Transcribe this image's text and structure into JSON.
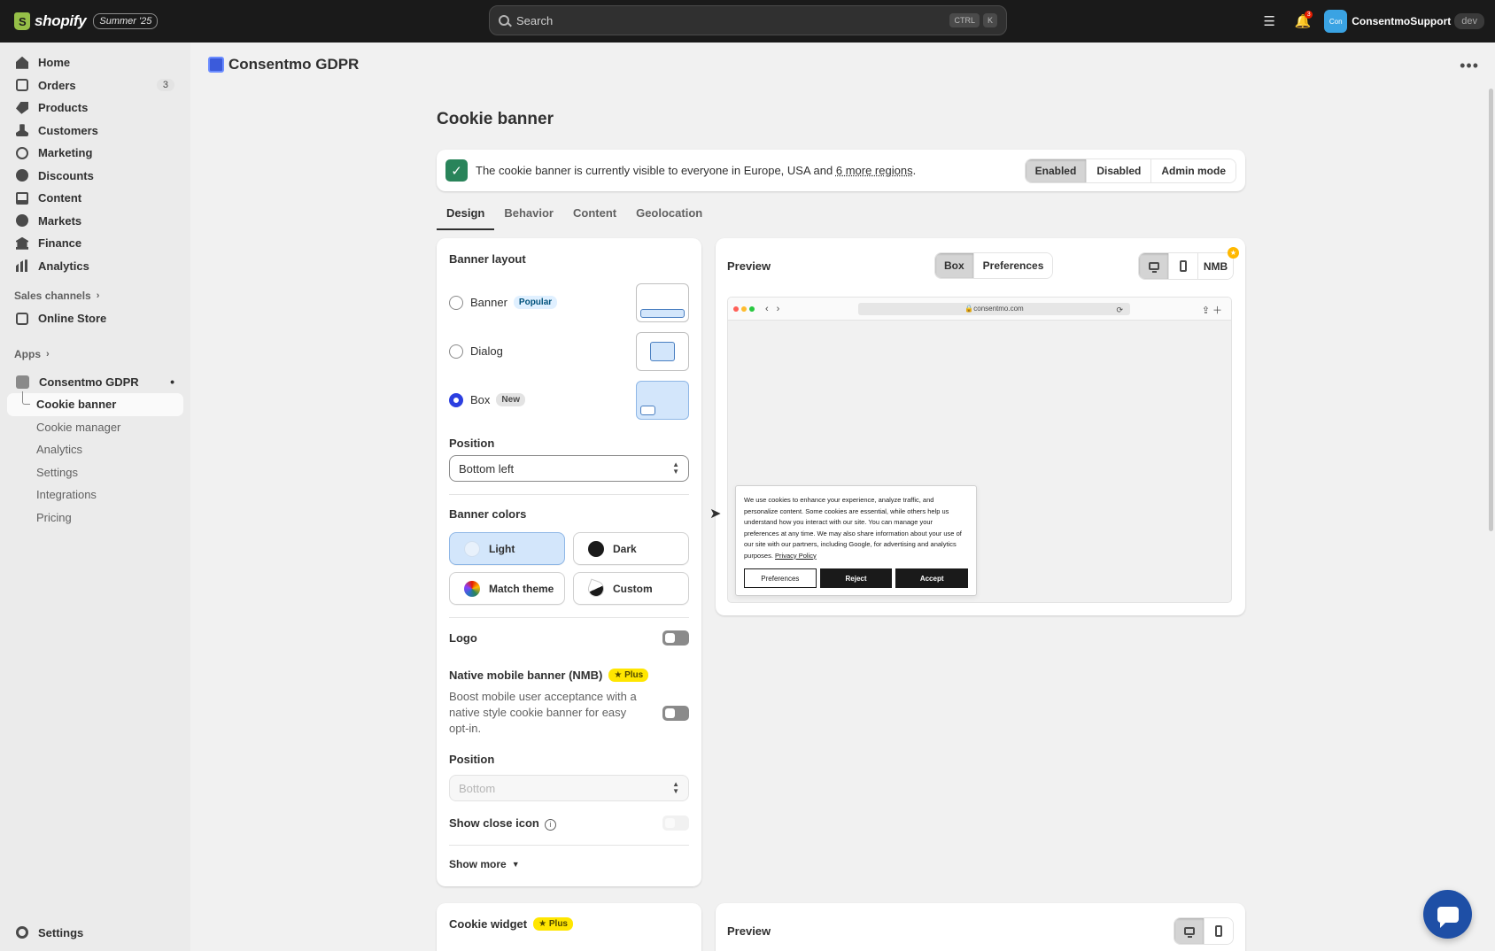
{
  "topbar": {
    "brand": "shopify",
    "edition": "Summer '25",
    "search_placeholder": "Search",
    "shortcut_mod": "CTRL",
    "shortcut_key": "K",
    "notification_count": "3",
    "account_initials": "Con",
    "account_name": "ConsentmoSupport",
    "account_badge": "dev"
  },
  "sidebar": {
    "items": [
      {
        "label": "Home",
        "icon": "home-icon"
      },
      {
        "label": "Orders",
        "icon": "orders-icon",
        "badge": "3"
      },
      {
        "label": "Products",
        "icon": "tag-icon"
      },
      {
        "label": "Customers",
        "icon": "person-icon"
      },
      {
        "label": "Marketing",
        "icon": "target-icon"
      },
      {
        "label": "Discounts",
        "icon": "discount-icon"
      },
      {
        "label": "Content",
        "icon": "content-icon"
      },
      {
        "label": "Markets",
        "icon": "globe-icon"
      },
      {
        "label": "Finance",
        "icon": "bank-icon"
      },
      {
        "label": "Analytics",
        "icon": "bar-chart-icon"
      }
    ],
    "sales_channels_label": "Sales channels",
    "online_store_label": "Online Store",
    "apps_label": "Apps",
    "app_name": "Consentmo GDPR",
    "app_subitems": [
      "Cookie banner",
      "Cookie manager",
      "Analytics",
      "Settings",
      "Integrations",
      "Pricing"
    ],
    "settings_label": "Settings"
  },
  "header": {
    "app_title": "Consentmo GDPR",
    "page_title": "Cookie banner"
  },
  "status": {
    "text_prefix": "The cookie banner is currently visible to everyone in Europe, USA and",
    "text_link": "6 more regions",
    "text_suffix": ".",
    "modes": [
      "Enabled",
      "Disabled",
      "Admin mode"
    ],
    "active_mode": "Enabled"
  },
  "tabs": [
    "Design",
    "Behavior",
    "Content",
    "Geolocation"
  ],
  "design": {
    "layout_heading": "Banner layout",
    "layouts": [
      {
        "label": "Banner",
        "badge": "Popular",
        "selected": false
      },
      {
        "label": "Dialog",
        "badge": "",
        "selected": false
      },
      {
        "label": "Box",
        "badge": "New",
        "selected": true
      }
    ],
    "position_label": "Position",
    "position_value": "Bottom left",
    "colors_heading": "Banner colors",
    "colors": [
      "Light",
      "Dark",
      "Match theme",
      "Custom"
    ],
    "selected_color": "Light",
    "logo_label": "Logo",
    "nmb_label": "Native mobile banner (NMB)",
    "nmb_badge": "Plus",
    "nmb_desc": "Boost mobile user acceptance with a native style cookie banner for easy opt-in.",
    "nmb_position_label": "Position",
    "nmb_position_value": "Bottom",
    "close_icon_label": "Show close icon",
    "show_more_label": "Show more"
  },
  "preview": {
    "heading": "Preview",
    "modes": [
      "Box",
      "Preferences"
    ],
    "active_mode": "Box",
    "nmb_label": "NMB",
    "url": "consentmo.com",
    "cookie_text": "We use cookies to enhance your experience, analyze traffic, and personalize content. Some cookies are essential, while others help us understand how you interact with our site. You can manage your preferences at any time. We may also share information about your use of our site with our partners, including Google, for advertising and analytics purposes.",
    "privacy_link": "Privacy Policy",
    "buttons": [
      "Preferences",
      "Reject",
      "Accept"
    ]
  },
  "widget": {
    "heading": "Cookie widget",
    "badge": "Plus",
    "preview_heading": "Preview"
  },
  "colors": {
    "accent": "#2c3fe0",
    "success": "#29845a",
    "topbar": "#1a1a1a"
  }
}
